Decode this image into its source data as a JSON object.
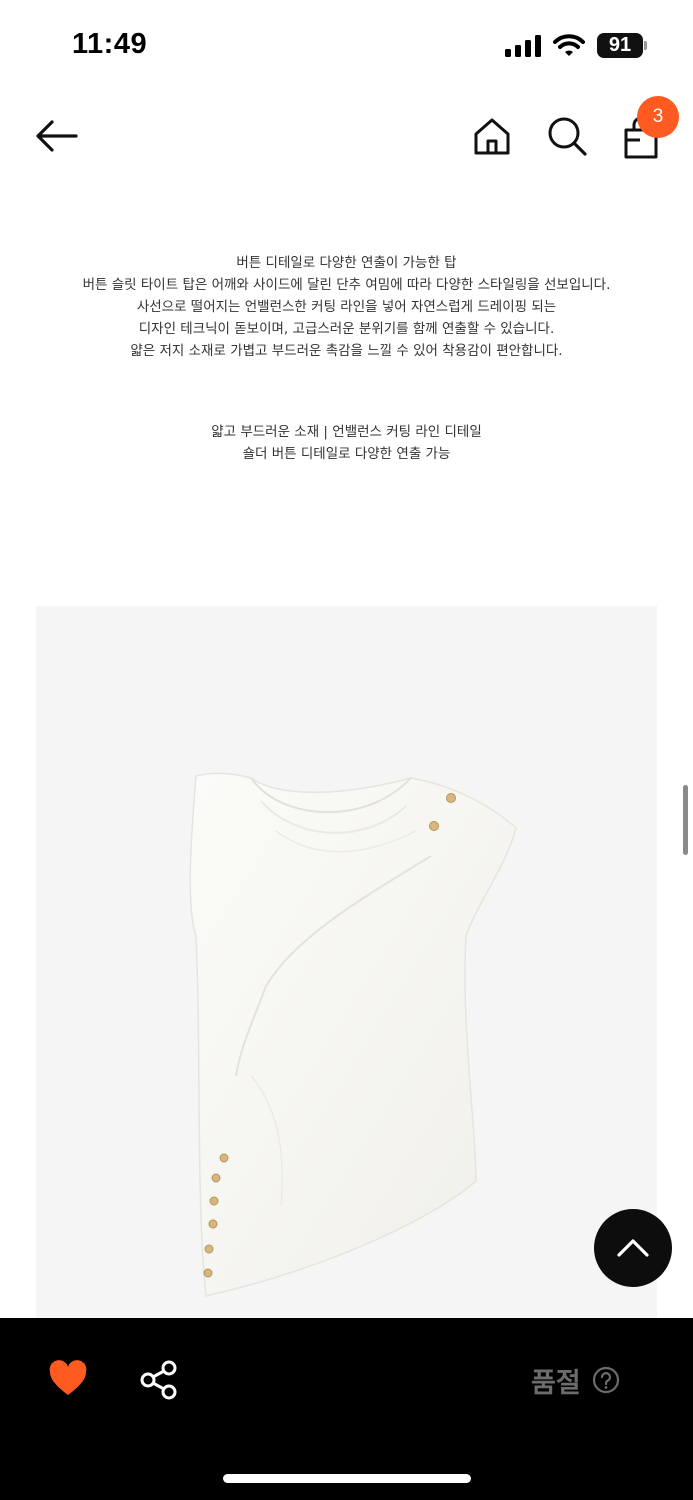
{
  "status_bar": {
    "time": "11:49",
    "battery": "91",
    "icons": [
      "signal-icon",
      "wifi-icon",
      "battery-icon"
    ]
  },
  "header": {
    "icons": [
      "back-icon",
      "home-icon",
      "search-icon",
      "bag-icon"
    ],
    "cart_count": "3"
  },
  "description": {
    "lines": [
      "버튼 디테일로 다양한 연출이 가능한  탑",
      "버튼 슬릿 타이트 탑은 어깨와 사이드에 달린 단추 여밈에 따라 다양한 스타일링을 선보입니다.",
      "사선으로 떨어지는 언밸런스한 커팅 라인을 넣어 자연스럽게 드레이핑 되는",
      "디자인 테크닉이 돋보이며, 고급스러운 분위기를 함께 연출할 수 있습니다.",
      "얇은 저지 소재로 가볍고 부드러운 촉감을 느낄 수 있어 착용감이 편안합니다."
    ],
    "features": [
      "얇고 부드러운 소재  | 언밸런스 커팅 라인 디테일",
      "숄더 버튼 디테일로 다양한 연출 가능"
    ]
  },
  "bottom_bar": {
    "sold_out_label": "품절",
    "icons": [
      "heart-icon",
      "share-icon",
      "help-icon"
    ]
  },
  "colors": {
    "accent": "#ff5a1f",
    "bottom_bar_bg": "#000000",
    "image_bg": "#f5f5f5",
    "sold_out_text": "#6c6c6c"
  }
}
